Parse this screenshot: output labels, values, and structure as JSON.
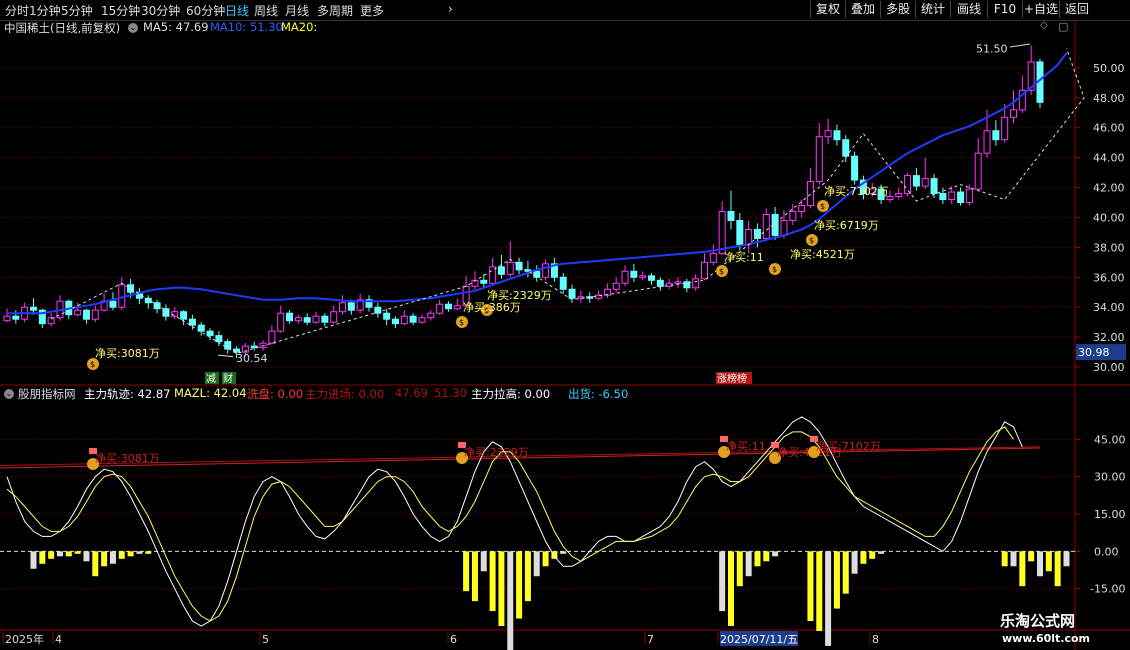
{
  "toolbar": {
    "left_items": [
      "分时",
      "1分钟",
      "5分钟",
      "15分钟",
      "30分钟",
      "60分钟",
      "日线",
      "周线",
      "月线",
      "多周期",
      "更多"
    ],
    "active": "日线",
    "right_items": [
      "复权",
      "叠加",
      "多股",
      "统计",
      "画线",
      "F10",
      "+自选",
      "返回"
    ]
  },
  "main_info": {
    "title": "中国稀土(日线,前复权)",
    "ma5": "MA5: 47.69",
    "ma10": "MA10: 51.30",
    "ma20": "MA20:"
  },
  "sub_info": {
    "title": "股朋指标网",
    "items": [
      {
        "text": "主力轨迹: 42.87",
        "color": "#ffffff"
      },
      {
        "text": "MAZL: 42.04",
        "color": "#ffff66"
      },
      {
        "text": "洗盘: 0.00",
        "color": "#ff3333"
      },
      {
        "text": "主力进场: 0.00",
        "color": "#bb1111"
      },
      {
        "text": "47.69",
        "color": "#aa1111"
      },
      {
        "text": "51.30",
        "color": "#aa1111"
      },
      {
        "text": "主力拉高: 0.00",
        "color": "#ffffff"
      },
      {
        "text": "出货: -6.50",
        "color": "#3cf"
      }
    ]
  },
  "price_axis": {
    "ticks": [
      "30.00",
      "32.00",
      "34.00",
      "36.00",
      "38.00",
      "40.00",
      "42.00",
      "44.00",
      "46.00",
      "48.00",
      "50.00"
    ],
    "current": "30.98"
  },
  "sub_axis": {
    "ticks": [
      "45.00",
      "30.00",
      "15.00",
      "0.00",
      "-15.00"
    ]
  },
  "date_axis": {
    "labels": [
      "2025年",
      "4",
      "5",
      "6",
      "7",
      "2025/07/11/五",
      "8"
    ]
  },
  "annotations": {
    "high_label": "51.50",
    "low_label": "30.54",
    "buys": [
      "净买:3081万",
      "净买:2329万",
      "净买:386万",
      "净买:11",
      "净买:4521万",
      "净买:6719万",
      "净买:7102万"
    ],
    "sub_buys": [
      "净买:3081万",
      "净买:2329万",
      "净买:11",
      "净买:4521万",
      "净买:7102万"
    ],
    "tags": [
      "减",
      "财",
      "涨榜榜"
    ]
  },
  "watermark": {
    "line1": "乐淘公式网",
    "line2": "www.60lt.com"
  },
  "colors": {
    "up": "#ff33ff",
    "down": "#66ffff",
    "ma": "#1e3cff",
    "grid": "#5a0000"
  },
  "chart_data": {
    "type": "candlestick",
    "ylim": [
      29,
      52
    ],
    "candles": [
      [
        33.1,
        33.4,
        33.9,
        33.0
      ],
      [
        33.4,
        33.2,
        33.8,
        32.9
      ],
      [
        33.2,
        34.0,
        34.3,
        33.0
      ],
      [
        34.0,
        33.8,
        34.6,
        33.5
      ],
      [
        33.8,
        32.9,
        33.9,
        32.6
      ],
      [
        32.9,
        33.3,
        33.6,
        32.7
      ],
      [
        33.3,
        34.4,
        34.8,
        33.1
      ],
      [
        34.4,
        33.5,
        34.5,
        33.2
      ],
      [
        33.5,
        33.8,
        34.3,
        33.4
      ],
      [
        33.8,
        33.2,
        33.9,
        32.9
      ],
      [
        33.2,
        33.8,
        34.1,
        33.0
      ],
      [
        33.8,
        34.4,
        34.9,
        33.7
      ],
      [
        34.4,
        34.0,
        35.0,
        33.8
      ],
      [
        34.0,
        35.5,
        36.0,
        33.8
      ],
      [
        35.5,
        35.0,
        35.9,
        34.6
      ],
      [
        35.0,
        34.6,
        35.3,
        34.2
      ],
      [
        34.6,
        34.3,
        34.8,
        33.9
      ],
      [
        34.3,
        33.9,
        34.5,
        33.6
      ],
      [
        33.9,
        33.4,
        34.2,
        33.1
      ],
      [
        33.4,
        33.7,
        34.0,
        33.2
      ],
      [
        33.7,
        33.2,
        33.8,
        32.8
      ],
      [
        33.2,
        32.8,
        33.5,
        32.5
      ],
      [
        32.8,
        32.4,
        33.0,
        32.1
      ],
      [
        32.4,
        32.1,
        32.6,
        31.8
      ],
      [
        32.1,
        31.7,
        32.4,
        31.4
      ],
      [
        31.7,
        31.2,
        31.9,
        30.9
      ],
      [
        31.2,
        31.0,
        31.4,
        30.6
      ],
      [
        31.0,
        31.4,
        31.6,
        30.7
      ],
      [
        31.4,
        31.3,
        31.7,
        31.1
      ],
      [
        31.3,
        31.6,
        31.8,
        31.1
      ],
      [
        31.6,
        32.4,
        32.8,
        31.5
      ],
      [
        32.4,
        33.6,
        34.1,
        32.3
      ],
      [
        33.6,
        33.1,
        33.8,
        32.9
      ],
      [
        33.1,
        33.3,
        33.5,
        32.9
      ],
      [
        33.3,
        33.0,
        33.6,
        32.8
      ],
      [
        33.0,
        33.4,
        33.7,
        32.9
      ],
      [
        33.4,
        33.0,
        33.6,
        32.7
      ],
      [
        33.0,
        33.7,
        34.1,
        32.9
      ],
      [
        33.7,
        34.3,
        34.8,
        33.5
      ],
      [
        34.3,
        33.8,
        34.5,
        33.5
      ],
      [
        33.8,
        34.5,
        34.9,
        33.6
      ],
      [
        34.5,
        34.0,
        34.8,
        33.7
      ],
      [
        34.0,
        33.6,
        34.3,
        33.3
      ],
      [
        33.6,
        33.2,
        33.9,
        32.8
      ],
      [
        33.2,
        32.9,
        33.4,
        32.6
      ],
      [
        32.9,
        33.4,
        33.8,
        32.8
      ],
      [
        33.4,
        33.0,
        33.6,
        32.8
      ],
      [
        33.0,
        33.3,
        33.5,
        32.9
      ],
      [
        33.3,
        33.6,
        33.8,
        33.1
      ],
      [
        33.6,
        34.2,
        34.5,
        33.5
      ],
      [
        34.2,
        33.9,
        34.4,
        33.7
      ],
      [
        33.9,
        34.1,
        34.6,
        33.8
      ],
      [
        34.1,
        35.4,
        36.1,
        34.0
      ],
      [
        35.4,
        35.8,
        36.4,
        35.2
      ],
      [
        35.8,
        35.6,
        36.2,
        35.3
      ],
      [
        35.6,
        36.7,
        37.3,
        35.5
      ],
      [
        36.7,
        36.2,
        37.5,
        35.9
      ],
      [
        36.2,
        37.0,
        38.4,
        36.0
      ],
      [
        37.0,
        36.5,
        37.3,
        36.2
      ],
      [
        36.5,
        36.4,
        37.1,
        36.0
      ],
      [
        36.4,
        36.0,
        36.8,
        35.7
      ],
      [
        36.0,
        36.9,
        37.2,
        35.8
      ],
      [
        36.9,
        36.0,
        37.3,
        35.7
      ],
      [
        36.0,
        35.2,
        36.3,
        34.9
      ],
      [
        35.2,
        34.6,
        35.5,
        34.3
      ],
      [
        34.6,
        34.7,
        35.1,
        34.3
      ],
      [
        34.7,
        34.6,
        35.0,
        34.3
      ],
      [
        34.6,
        34.8,
        35.1,
        34.5
      ],
      [
        34.8,
        35.2,
        35.6,
        34.6
      ],
      [
        35.2,
        35.6,
        36.0,
        35.0
      ],
      [
        35.6,
        36.4,
        36.8,
        35.4
      ],
      [
        36.4,
        36.0,
        36.9,
        35.7
      ],
      [
        36.0,
        36.1,
        36.4,
        35.8
      ],
      [
        36.1,
        35.8,
        36.3,
        35.5
      ],
      [
        35.8,
        35.4,
        36.0,
        35.1
      ],
      [
        35.4,
        35.6,
        35.9,
        35.2
      ],
      [
        35.6,
        35.7,
        36.0,
        35.3
      ],
      [
        35.7,
        35.3,
        35.9,
        35.0
      ],
      [
        35.3,
        35.9,
        36.2,
        35.1
      ],
      [
        35.9,
        37.0,
        37.6,
        35.8
      ],
      [
        37.0,
        37.6,
        38.2,
        36.8
      ],
      [
        37.6,
        40.4,
        41.1,
        37.5
      ],
      [
        40.4,
        39.8,
        41.8,
        39.2
      ],
      [
        39.8,
        38.2,
        40.3,
        37.8
      ],
      [
        38.2,
        39.2,
        39.8,
        37.6
      ],
      [
        39.2,
        38.6,
        39.6,
        38.0
      ],
      [
        38.6,
        40.2,
        40.6,
        38.4
      ],
      [
        40.2,
        38.8,
        40.7,
        38.5
      ],
      [
        38.8,
        39.8,
        40.5,
        38.6
      ],
      [
        39.8,
        40.4,
        40.9,
        39.5
      ],
      [
        40.4,
        40.8,
        41.2,
        40.0
      ],
      [
        40.8,
        42.4,
        43.3,
        40.6
      ],
      [
        42.4,
        45.4,
        46.3,
        42.2
      ],
      [
        45.4,
        45.8,
        46.6,
        44.9
      ],
      [
        45.8,
        45.2,
        46.2,
        44.8
      ],
      [
        45.2,
        44.1,
        45.5,
        43.7
      ],
      [
        44.1,
        42.5,
        44.4,
        42.2
      ],
      [
        42.5,
        41.6,
        42.8,
        41.2
      ],
      [
        41.6,
        41.9,
        42.3,
        41.4
      ],
      [
        41.9,
        41.2,
        42.2,
        40.9
      ],
      [
        41.2,
        41.4,
        41.8,
        41.0
      ],
      [
        41.4,
        41.6,
        42.0,
        41.2
      ],
      [
        41.6,
        42.8,
        43.0,
        41.4
      ],
      [
        42.8,
        42.1,
        43.3,
        41.8
      ],
      [
        42.1,
        42.6,
        44.0,
        41.9
      ],
      [
        42.6,
        41.6,
        42.9,
        41.3
      ],
      [
        41.6,
        41.2,
        42.0,
        40.9
      ],
      [
        41.2,
        41.7,
        42.1,
        40.9
      ],
      [
        41.7,
        41.0,
        42.0,
        40.8
      ],
      [
        41.0,
        41.9,
        42.2,
        40.8
      ],
      [
        41.9,
        44.3,
        45.3,
        41.8
      ],
      [
        44.3,
        45.8,
        47.2,
        44.0
      ],
      [
        45.8,
        45.2,
        46.5,
        44.8
      ],
      [
        45.2,
        46.7,
        47.6,
        45.0
      ],
      [
        46.7,
        47.2,
        48.5,
        46.3
      ],
      [
        47.2,
        48.5,
        49.5,
        47.0
      ],
      [
        48.5,
        50.4,
        51.5,
        48.2
      ],
      [
        50.4,
        47.7,
        50.6,
        47.3
      ]
    ],
    "ma_series": [
      33.6,
      33.6,
      33.6,
      33.6,
      33.6,
      33.7,
      33.8,
      33.9,
      34.0,
      34.1,
      34.2,
      34.35,
      34.5,
      34.65,
      34.8,
      34.95,
      35.1,
      35.2,
      35.25,
      35.3,
      35.3,
      35.25,
      35.2,
      35.1,
      35.0,
      34.9,
      34.8,
      34.7,
      34.6,
      34.5,
      34.5,
      34.5,
      34.55,
      34.6,
      34.6,
      34.6,
      34.55,
      34.5,
      34.45,
      34.4,
      34.4,
      34.4,
      34.4,
      34.4,
      34.4,
      34.45,
      34.5,
      34.55,
      34.6,
      34.7,
      34.8,
      34.9,
      35.0,
      35.1,
      35.3,
      35.5,
      35.7,
      35.9,
      36.1,
      36.3,
      36.5,
      36.65,
      36.8,
      36.9,
      36.95,
      37.0,
      37.05,
      37.1,
      37.15,
      37.2,
      37.25,
      37.3,
      37.35,
      37.4,
      37.45,
      37.5,
      37.55,
      37.6,
      37.65,
      37.7,
      37.8,
      37.9,
      38.0,
      38.1,
      38.2,
      38.35,
      38.5,
      38.65,
      38.8,
      39.0,
      39.2,
      39.5,
      39.9,
      40.4,
      40.9,
      41.4,
      41.9,
      42.3,
      42.7,
      43.1,
      43.5,
      43.9,
      44.3,
      44.6,
      44.9,
      45.2,
      45.5,
      45.7,
      45.9,
      46.1,
      46.4,
      46.7,
      47.0,
      47.3,
      47.7,
      48.2,
      48.7,
      49.2,
      49.7,
      50.2,
      51.0
    ],
    "sub_series": {
      "main_trace": [
        30,
        20,
        12,
        8,
        6,
        6,
        8,
        12,
        18,
        25,
        30,
        33,
        32,
        28,
        22,
        15,
        8,
        0,
        -8,
        -15,
        -22,
        -28,
        -30,
        -28,
        -22,
        -12,
        0,
        12,
        22,
        28,
        30,
        28,
        22,
        15,
        10,
        6,
        5,
        8,
        12,
        18,
        24,
        30,
        33,
        32,
        28,
        22,
        15,
        10,
        6,
        4,
        6,
        12,
        22,
        32,
        40,
        44,
        42,
        36,
        28,
        20,
        12,
        4,
        -2,
        -6,
        -6,
        -4,
        0,
        4,
        6,
        6,
        4,
        4,
        6,
        8,
        10,
        14,
        20,
        28,
        34,
        36,
        33,
        28,
        26,
        28,
        32,
        36,
        40,
        44,
        48,
        52,
        54,
        52,
        48,
        42,
        35,
        28,
        22,
        18,
        16,
        14,
        12,
        10,
        8,
        6,
        4,
        2,
        0,
        4,
        12,
        22,
        32,
        40,
        46,
        52,
        50,
        42
      ],
      "mazl": [
        25,
        22,
        18,
        14,
        10,
        8,
        8,
        10,
        14,
        20,
        26,
        30,
        31,
        30,
        26,
        20,
        14,
        6,
        -2,
        -10,
        -16,
        -22,
        -26,
        -28,
        -26,
        -20,
        -10,
        2,
        14,
        22,
        27,
        28,
        26,
        22,
        18,
        14,
        10,
        10,
        12,
        16,
        20,
        24,
        28,
        30,
        30,
        28,
        24,
        18,
        14,
        10,
        8,
        10,
        14,
        20,
        28,
        36,
        40,
        40,
        36,
        30,
        24,
        16,
        8,
        2,
        -2,
        -4,
        -2,
        0,
        2,
        4,
        4,
        4,
        5,
        6,
        8,
        10,
        14,
        20,
        26,
        30,
        31,
        30,
        28,
        28,
        30,
        34,
        38,
        42,
        46,
        48,
        48,
        46,
        42,
        36,
        30,
        26,
        22,
        20,
        18,
        16,
        14,
        12,
        10,
        8,
        6,
        6,
        10,
        16,
        24,
        32,
        38,
        44,
        48,
        50,
        45
      ],
      "histogram": [
        0,
        0,
        0,
        -7,
        -5,
        -3,
        -2,
        -2,
        -1,
        -4,
        -10,
        -6,
        -5,
        -3,
        -2,
        -1,
        -1,
        0,
        0,
        0,
        0,
        0,
        0,
        0,
        0,
        0,
        0,
        0,
        0,
        0,
        0,
        0,
        0,
        0,
        0,
        0,
        0,
        0,
        0,
        0,
        0,
        0,
        0,
        0,
        0,
        0,
        0,
        0,
        0,
        0,
        0,
        0,
        -16,
        -20,
        -8,
        -24,
        -30,
        -40,
        -27,
        -20,
        -10,
        -6,
        -3,
        -1,
        0,
        0,
        0,
        0,
        0,
        0,
        0,
        0,
        0,
        0,
        0,
        0,
        0,
        0,
        0,
        0,
        0,
        -24,
        -30,
        -14,
        -10,
        -6,
        -4,
        -2,
        0,
        0,
        0,
        -28,
        -32,
        -38,
        -23,
        -17,
        -9,
        -5,
        -3,
        -1,
        0,
        0,
        0,
        0,
        0,
        0,
        0,
        0,
        0,
        0,
        0,
        0,
        0,
        -6,
        -6,
        -14,
        -4,
        -10,
        -8,
        -14,
        -6
      ],
      "ylim": [
        -30,
        60
      ],
      "ma_lines": [
        [
          33.5,
          41.5
        ],
        [
          34.5,
          42
        ]
      ]
    }
  }
}
